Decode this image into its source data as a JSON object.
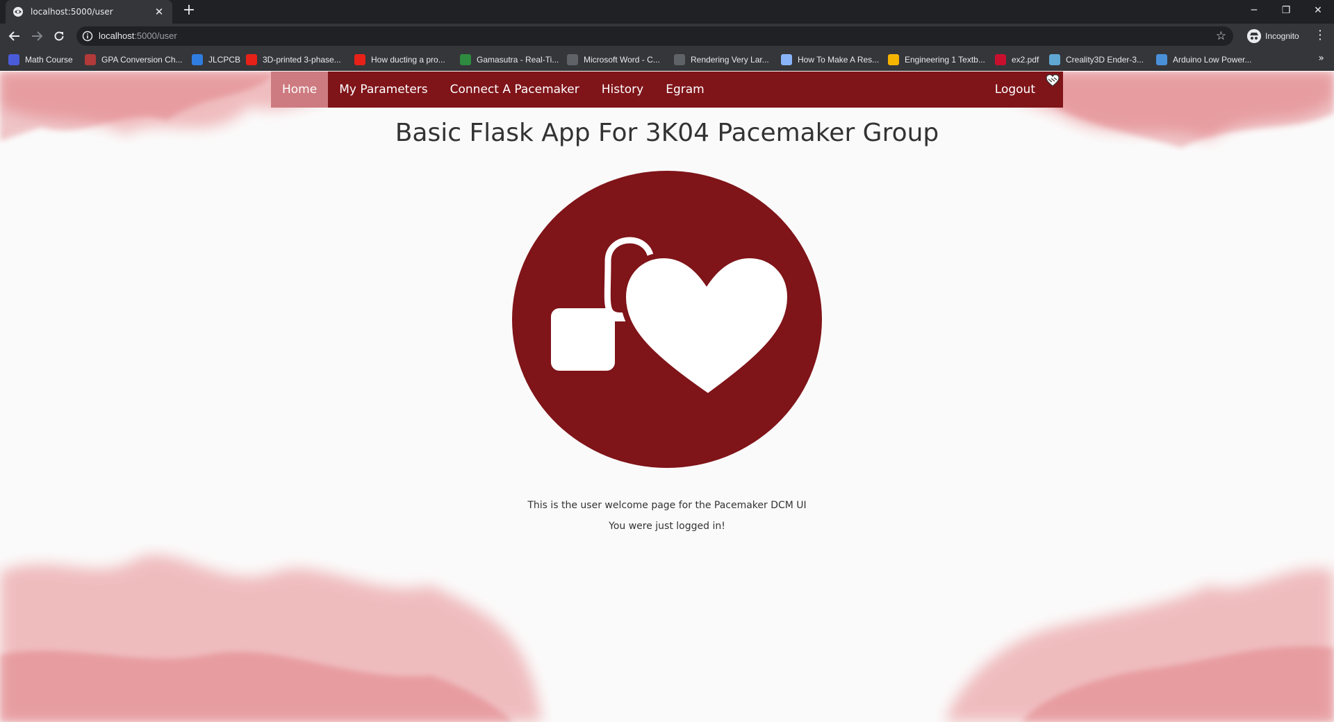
{
  "browser": {
    "tab_title": "localhost:5000/user",
    "tab_close": "✕",
    "new_tab": "+",
    "url_host": "localhost",
    "url_path": ":5000/user",
    "profile_label": "Incognito",
    "window_controls": {
      "minimize": "─",
      "restore": "❐",
      "close": "✕"
    },
    "bookmarks": [
      {
        "label": "Math Course",
        "icon": "sigma-icon",
        "color": "#4a5bd9"
      },
      {
        "label": "GPA Conversion Ch...",
        "icon": "gpa-icon",
        "color": "#b23a3a"
      },
      {
        "label": "JLCPCB",
        "icon": "jlc-icon",
        "color": "#2f7de1"
      },
      {
        "label": "3D-printed 3-phase...",
        "icon": "youtube-icon",
        "color": "#e62117"
      },
      {
        "label": "How ducting a pro...",
        "icon": "youtube-icon",
        "color": "#e62117"
      },
      {
        "label": "Gamasutra - Real-Ti...",
        "icon": "gamasutra-icon",
        "color": "#2e8b3f"
      },
      {
        "label": "Microsoft Word - C...",
        "icon": "globe-icon",
        "color": "#5f6368"
      },
      {
        "label": "Rendering Very Lar...",
        "icon": "globe-icon",
        "color": "#5f6368"
      },
      {
        "label": "How To Make A Res...",
        "icon": "page-icon",
        "color": "#8ab4f8"
      },
      {
        "label": "Engineering 1 Textb...",
        "icon": "drive-icon",
        "color": "#f4b400"
      },
      {
        "label": "ex2.pdf",
        "icon": "u-icon",
        "color": "#c8102e"
      },
      {
        "label": "Creality3D Ender-3...",
        "icon": "image-icon",
        "color": "#5fa8d3"
      },
      {
        "label": "Arduino Low Power...",
        "icon": "hc-icon",
        "color": "#4a90d9"
      }
    ]
  },
  "nav": {
    "items": [
      {
        "label": "Home",
        "active": true
      },
      {
        "label": "My Parameters",
        "active": false
      },
      {
        "label": "Connect A Pacemaker",
        "active": false
      },
      {
        "label": "History",
        "active": false
      },
      {
        "label": "Egram",
        "active": false
      }
    ],
    "logout": "Logout"
  },
  "page": {
    "title": "Basic Flask App For 3K04 Pacemaker Group",
    "welcome_line1": "This is the user welcome page for the Pacemaker DCM UI",
    "welcome_line2": "You were just logged in!"
  },
  "colors": {
    "nav_bg": "#7f1419",
    "nav_active": "#cd7b80",
    "logo_circle": "#7f1419",
    "watercolor": "#e68a8e"
  }
}
